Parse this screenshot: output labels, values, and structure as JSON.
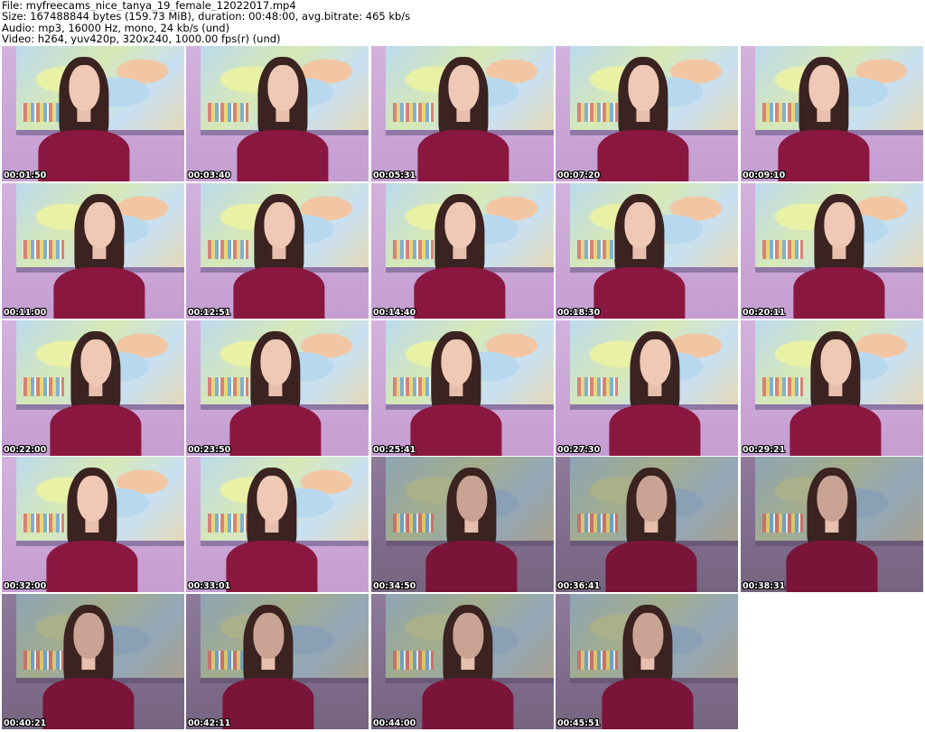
{
  "header": {
    "file_line": "File: myfreecams_nice_tanya_19_female_12022017.mp4",
    "size_line": "Size: 167488844 bytes (159.73 MiB), duration: 00:48:00, avg.bitrate: 465 kb/s",
    "audio_line": "Audio: mp3, 16000 Hz, mono, 24 kb/s (und)",
    "video_line": "Video: h264, yuv420p, 320x240, 1000.00 fps(r) (und)"
  },
  "thumbnails": [
    {
      "timestamp": "00:01:50",
      "lighting": "bright"
    },
    {
      "timestamp": "00:03:40",
      "lighting": "bright"
    },
    {
      "timestamp": "00:05:31",
      "lighting": "bright"
    },
    {
      "timestamp": "00:07:20",
      "lighting": "bright"
    },
    {
      "timestamp": "00:09:10",
      "lighting": "bright"
    },
    {
      "timestamp": "00:11:00",
      "lighting": "bright"
    },
    {
      "timestamp": "00:12:51",
      "lighting": "bright"
    },
    {
      "timestamp": "00:14:40",
      "lighting": "bright"
    },
    {
      "timestamp": "00:18:30",
      "lighting": "bright"
    },
    {
      "timestamp": "00:20:11",
      "lighting": "bright"
    },
    {
      "timestamp": "00:22:00",
      "lighting": "bright"
    },
    {
      "timestamp": "00:23:50",
      "lighting": "bright"
    },
    {
      "timestamp": "00:25:41",
      "lighting": "bright"
    },
    {
      "timestamp": "00:27:30",
      "lighting": "bright"
    },
    {
      "timestamp": "00:29:21",
      "lighting": "bright"
    },
    {
      "timestamp": "00:32:00",
      "lighting": "bright"
    },
    {
      "timestamp": "00:33:01",
      "lighting": "bright"
    },
    {
      "timestamp": "00:34:50",
      "lighting": "dim"
    },
    {
      "timestamp": "00:36:41",
      "lighting": "dim"
    },
    {
      "timestamp": "00:38:31",
      "lighting": "dim"
    },
    {
      "timestamp": "00:40:21",
      "lighting": "dim"
    },
    {
      "timestamp": "00:42:11",
      "lighting": "dim"
    },
    {
      "timestamp": "00:44:00",
      "lighting": "dim"
    },
    {
      "timestamp": "00:45:51",
      "lighting": "dim"
    }
  ]
}
